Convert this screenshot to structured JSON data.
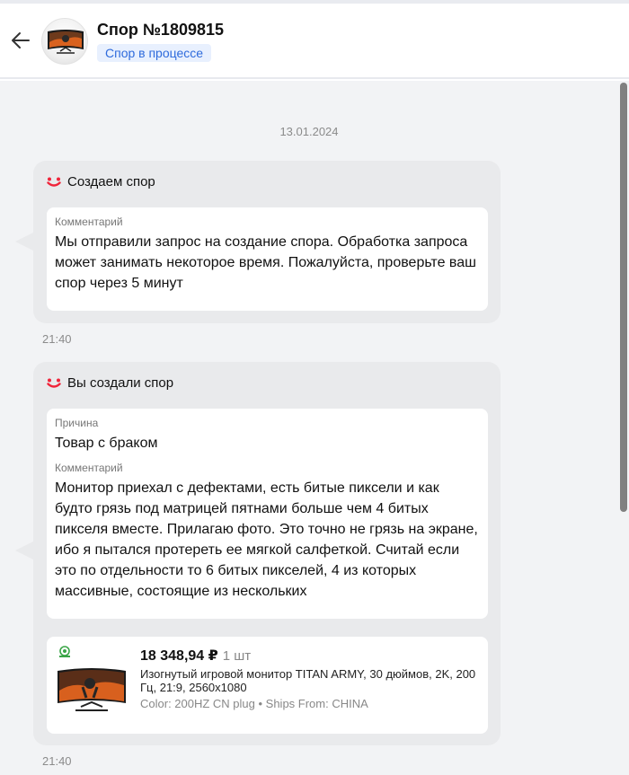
{
  "header": {
    "title": "Спор №1809815",
    "status": "Спор в процессе"
  },
  "chat": {
    "date": "13.01.2024",
    "messages": [
      {
        "title": "Создаем спор",
        "comment_label": "Комментарий",
        "comment": "Мы отправили запрос на создание спора. Обработка запроса может занимать некоторое время. Пожалуйста, проверьте ваш спор через 5 минут",
        "time": "21:40"
      },
      {
        "title": "Вы создали спор",
        "reason_label": "Причина",
        "reason": "Товар с браком",
        "comment_label": "Комментарий",
        "comment": "Монитор приехал с дефектами, есть битые пиксели и как будто грязь под матрицей пятнами больше чем 4 битых пикселя вместе. Прилагаю фото. Это точно не грязь на экране, ибо я пытался протереть ее мягкой салфеткой. Считай если это по отдельности то 6 битых пикселей, 4 из которых массивные, состоящие из нескольких",
        "product": {
          "price": "18 348,94 ₽",
          "quantity": "1 шт",
          "name": "Изогнутый игровой монитор TITAN ARMY, 30 дюймов, 2K, 200 Гц, 21:9, 2560x1080",
          "attributes": "Color: 200HZ  CN plug • Ships From: CHINA"
        },
        "time": "21:40"
      }
    ]
  },
  "colors": {
    "accent": "#2f6bdc",
    "badge_bg": "#e8f0fe",
    "brand_smile": "#f0243a",
    "bubble_bg": "#e9eaec",
    "chat_bg": "#f2f3f5"
  },
  "icons": [
    "back-arrow-icon",
    "smile-logo-icon",
    "seller-badge-icon"
  ]
}
